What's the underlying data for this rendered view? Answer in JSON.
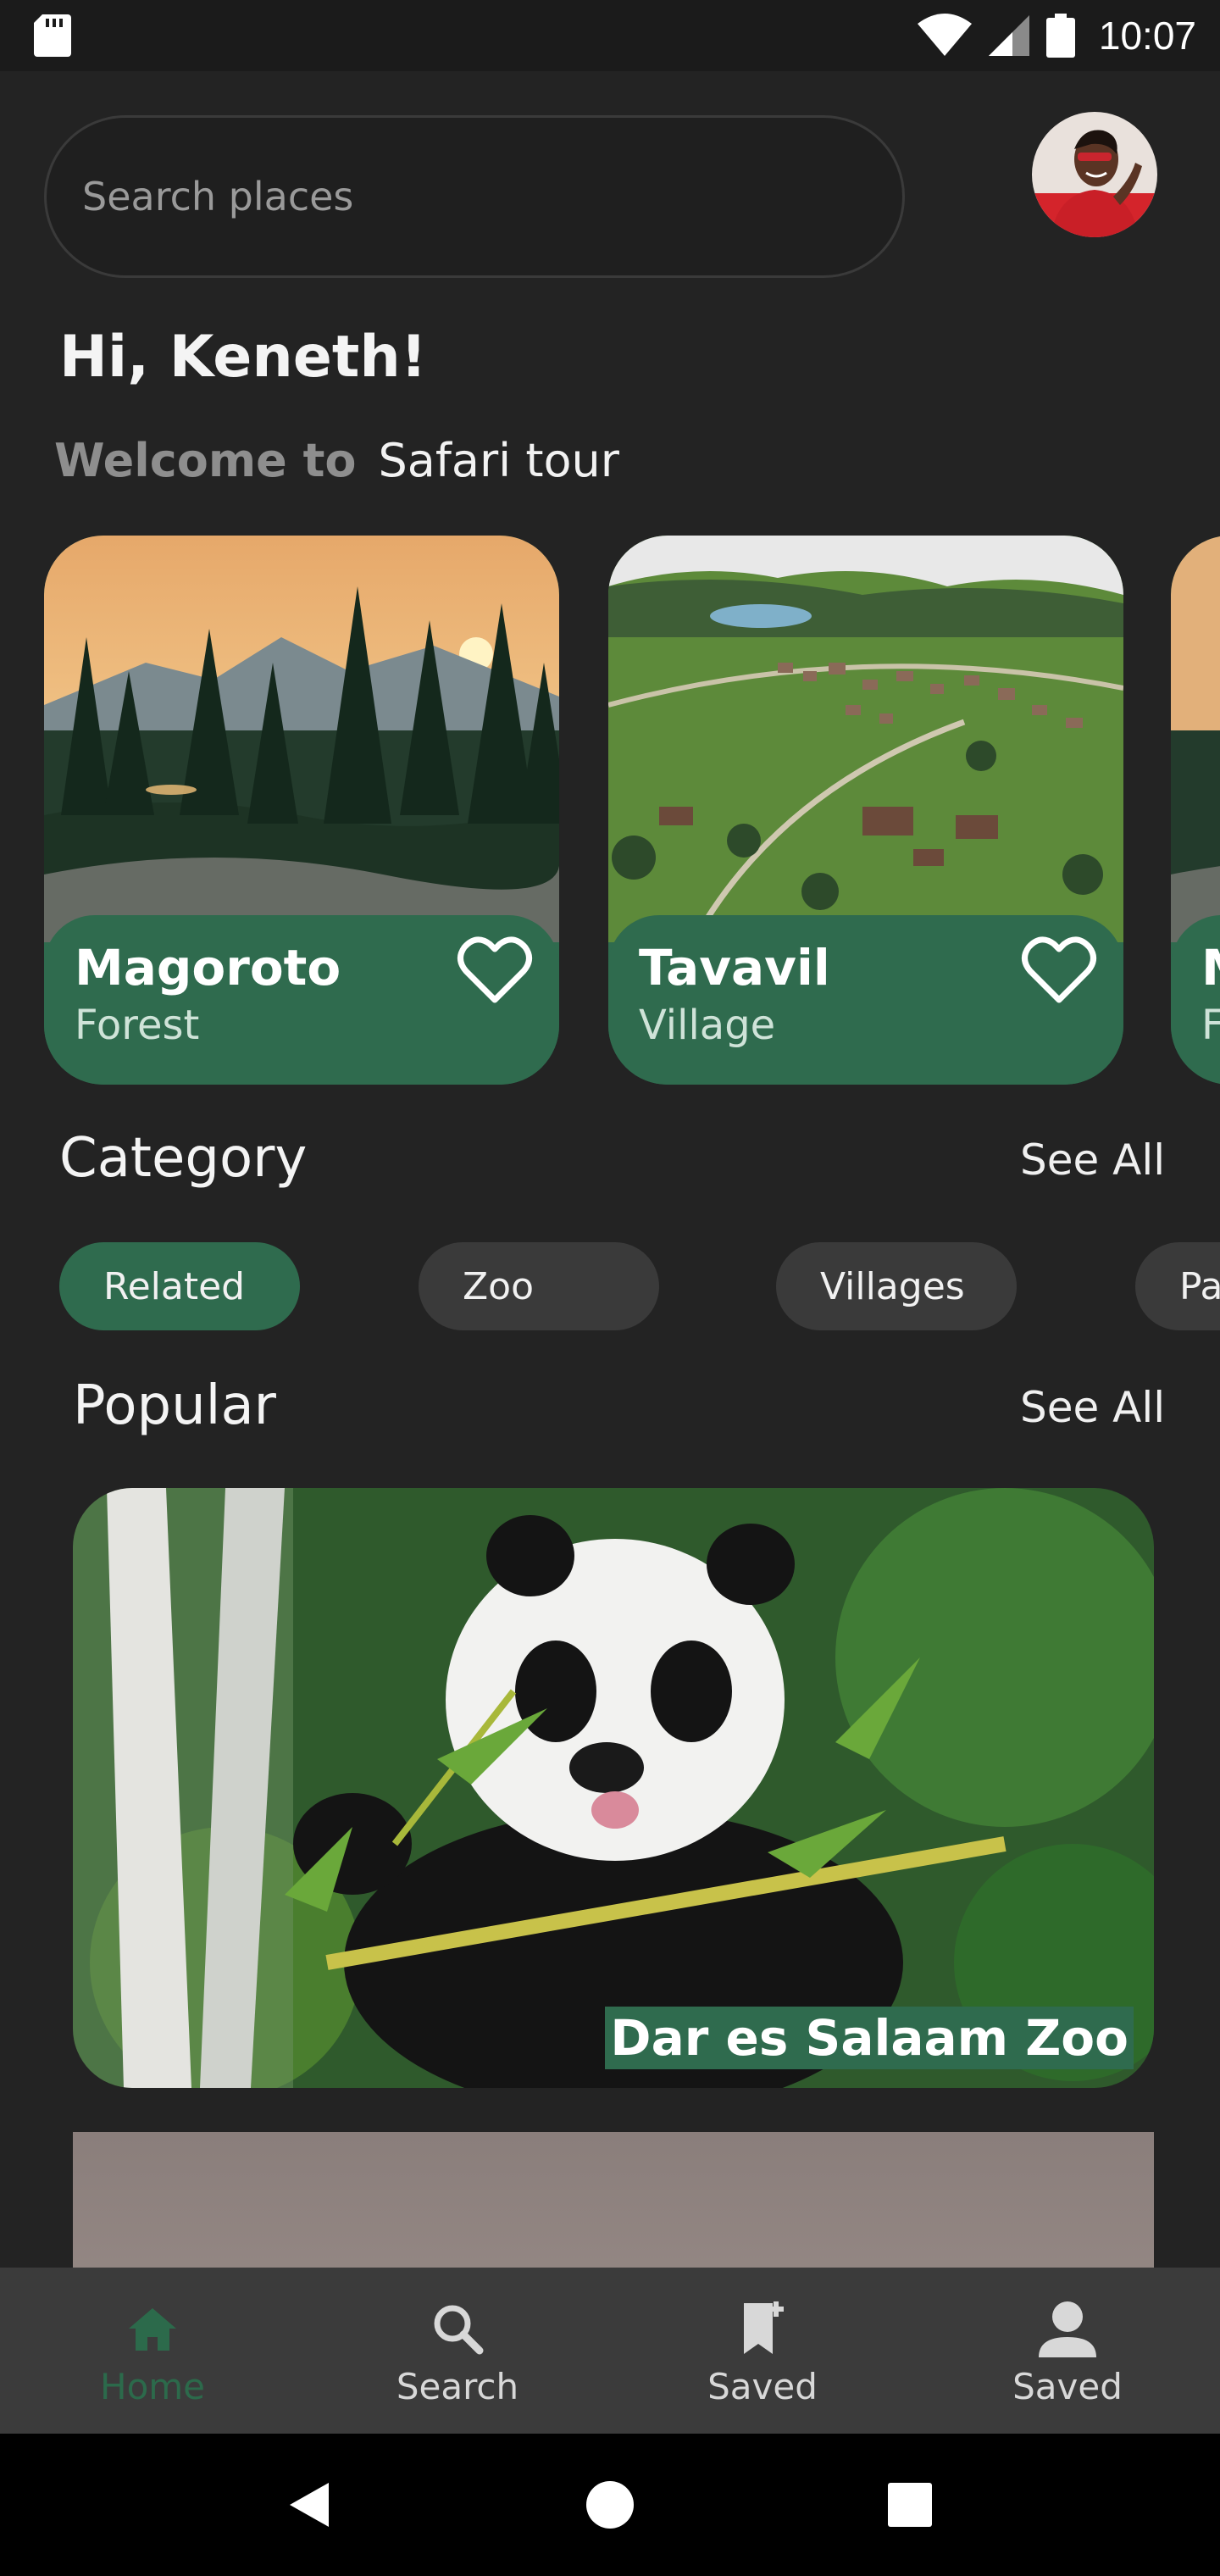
{
  "status_bar": {
    "time": "10:07"
  },
  "search": {
    "placeholder": "Search places"
  },
  "greeting": "Hi, Keneth!",
  "welcome": {
    "prefix": "Welcome to",
    "app_name": "Safari tour"
  },
  "places": [
    {
      "title": "Magoroto",
      "subtitle": "Forest"
    },
    {
      "title": "Tavavil",
      "subtitle": "Village"
    },
    {
      "title": "M",
      "subtitle": "F"
    }
  ],
  "category": {
    "title": "Category",
    "see_all": "See All",
    "chips": [
      "Related",
      "Zoo",
      "Villages",
      "Pa"
    ]
  },
  "popular": {
    "title": "Popular",
    "see_all": "See All",
    "items": [
      {
        "label": "Dar es Salaam Zoo"
      }
    ]
  },
  "bottom_nav": [
    {
      "label": "Home",
      "icon": "home-icon",
      "active": true
    },
    {
      "label": "Search",
      "icon": "search-icon",
      "active": false
    },
    {
      "label": "Saved",
      "icon": "bookmark-add-icon",
      "active": false
    },
    {
      "label": "Saved",
      "icon": "person-icon",
      "active": false
    }
  ],
  "colors": {
    "accent": "#2f6b4e",
    "background": "#232323",
    "chip": "#3a3a3a"
  }
}
